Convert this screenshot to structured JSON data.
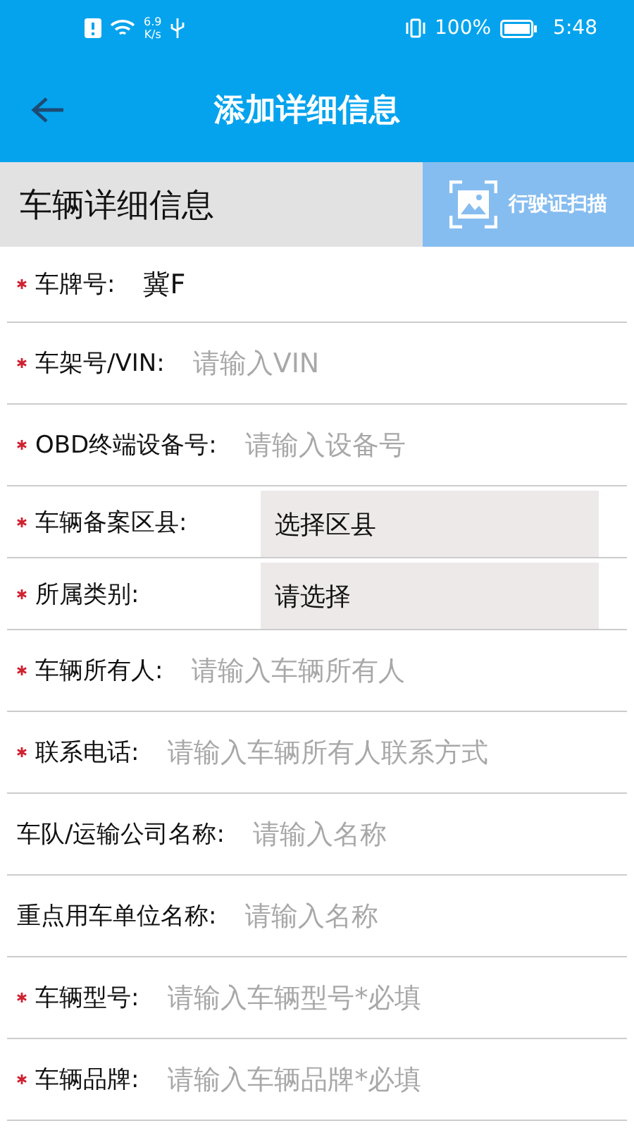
{
  "status_bar": {
    "speed_value": "6.9",
    "speed_unit": "K/s",
    "battery": "100%",
    "time": "5:48"
  },
  "header": {
    "title": "添加详细信息"
  },
  "section": {
    "title": "车辆详细信息",
    "scan_button": "行驶证扫描"
  },
  "rows": [
    {
      "required": true,
      "label": "车牌号:",
      "kind": "value",
      "value": "冀F"
    },
    {
      "required": true,
      "label": "车架号/VIN:",
      "kind": "input",
      "placeholder": "请输入VIN"
    },
    {
      "required": true,
      "label": "OBD终端设备号:",
      "kind": "input",
      "placeholder": "请输入设备号"
    },
    {
      "required": true,
      "label": "车辆备案区县:",
      "kind": "select",
      "value": "选择区县"
    },
    {
      "required": true,
      "label": "所属类别:",
      "kind": "select",
      "value": "请选择"
    },
    {
      "required": true,
      "label": "车辆所有人:",
      "kind": "input",
      "placeholder": "请输入车辆所有人"
    },
    {
      "required": true,
      "label": "联系电话:",
      "kind": "input",
      "placeholder": "请输入车辆所有人联系方式"
    },
    {
      "required": false,
      "label": "车队/运输公司名称:",
      "kind": "input",
      "placeholder": "请输入名称"
    },
    {
      "required": false,
      "label": "重点用车单位名称:",
      "kind": "input",
      "placeholder": "请输入名称"
    },
    {
      "required": true,
      "label": "车辆型号:",
      "kind": "input",
      "placeholder": "请输入车辆型号*必填"
    },
    {
      "required": true,
      "label": "车辆品牌:",
      "kind": "input",
      "placeholder": "请输入车辆品牌*必填"
    }
  ]
}
